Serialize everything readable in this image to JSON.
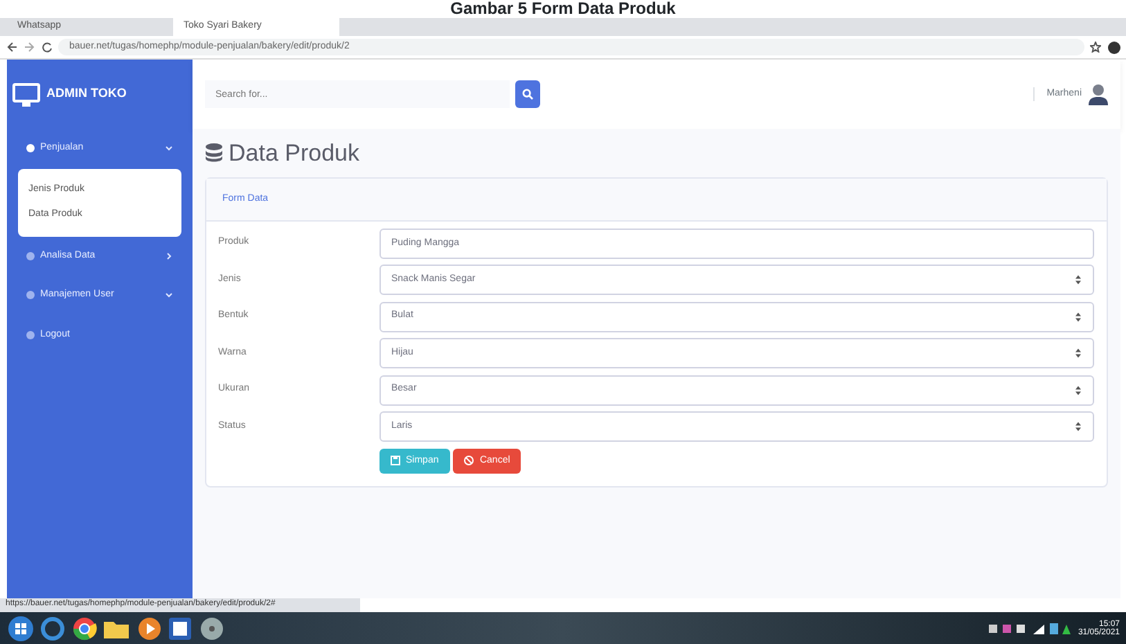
{
  "caption": "Gambar 5 Form Data Produk",
  "browser": {
    "tabs": [
      {
        "label": "Whatsapp",
        "selected": false
      },
      {
        "label": "Toko Syari Bakery",
        "selected": true
      }
    ],
    "url": "bauer.net/tugas/homephp/module-penjualan/bakery/edit/produk/2"
  },
  "sidebar": {
    "brand": "ADMIN TOKO",
    "items": [
      {
        "label": "Penjualan",
        "expanded": true,
        "children": [
          {
            "label": "Jenis Produk"
          },
          {
            "label": "Data Produk"
          }
        ]
      },
      {
        "label": "Analisa Data",
        "expanded": false
      },
      {
        "label": "Manajemen User",
        "expanded": true
      },
      {
        "label": "Logout"
      }
    ]
  },
  "topbar": {
    "search": {
      "placeholder": "Search for..."
    },
    "user": "Marheni"
  },
  "page_title": "Data Produk",
  "form": {
    "title": "Form Data",
    "fields": [
      {
        "label": "Produk",
        "kind": "text",
        "value": "Puding Mangga"
      },
      {
        "label": "Jenis",
        "kind": "select",
        "value": "Snack Manis Segar"
      },
      {
        "label": "Bentuk",
        "kind": "select",
        "value": "Bulat"
      },
      {
        "label": "Warna",
        "kind": "select",
        "value": "Hijau"
      },
      {
        "label": "Ukuran",
        "kind": "select",
        "value": "Besar"
      },
      {
        "label": "Status",
        "kind": "select",
        "value": "Laris"
      }
    ],
    "buttons": [
      {
        "label": "Simpan",
        "kind": "save"
      },
      {
        "label": "Cancel",
        "kind": "cancel"
      }
    ]
  },
  "status_url": "https://bauer.net/tugas/homephp/module-penjualan/bakery/edit/produk/2#",
  "taskbar": {
    "time": "15:07",
    "date": "31/05/2021"
  }
}
